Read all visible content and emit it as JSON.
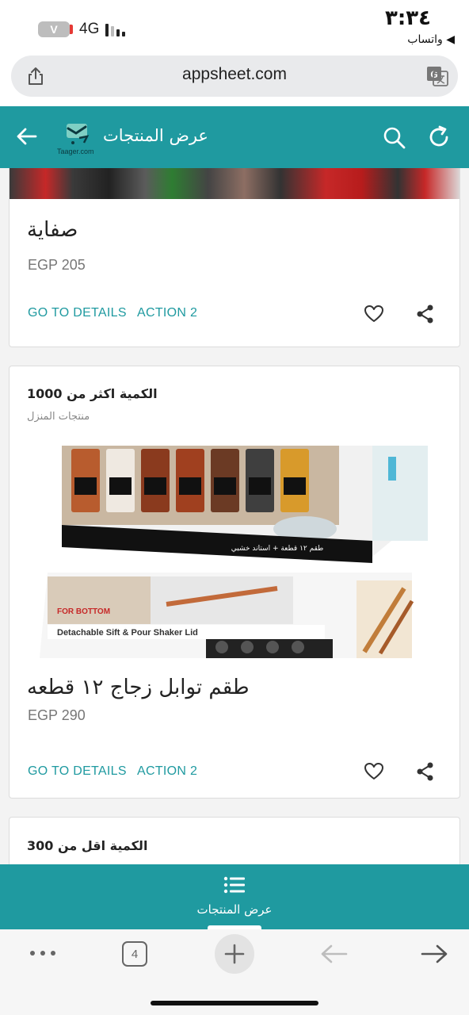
{
  "status_bar": {
    "sim_label": "V",
    "network": "4G",
    "time": "٣:٣٤",
    "back_app": "◀ واتساب"
  },
  "browser": {
    "url": "appsheet.com",
    "tab_count": "4"
  },
  "app_bar": {
    "title": "عرض المنتجات",
    "logo_text": "Taager.com"
  },
  "cards": [
    {
      "title": "صفاية",
      "price": "EGP 205",
      "action1": "GO TO DETAILS",
      "action2": "ACTION 2"
    },
    {
      "group_title": "الكمية اكثر من 1000",
      "group_subtitle": "منتجات المنزل",
      "image_caption_1": "طقم ١٢ قطعة + استاند خشبي",
      "image_caption_2": "Detachable Sift & Pour Shaker Lid",
      "image_caption_3": "FOR BOTTOM",
      "title": "طقم توابل زجاج ١٢ قطعه",
      "price": "EGP 290",
      "action1": "GO TO DETAILS",
      "action2": "ACTION 2"
    },
    {
      "group_title": "الكمية اقل من 300"
    }
  ],
  "bottom_nav": {
    "label": "عرض المنتجات"
  },
  "colors": {
    "primary": "#1f9aa0",
    "accent_text": "#1f9aa0"
  }
}
